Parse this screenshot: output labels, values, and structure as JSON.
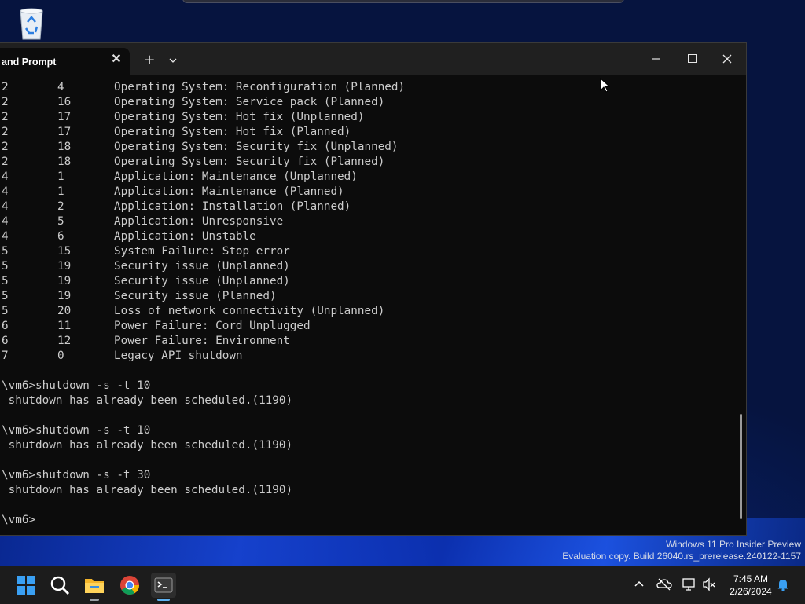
{
  "desktop": {
    "recycle_bin_icon": "recycle-bin-icon",
    "watermark_line1": "Windows 11 Pro Insider Preview",
    "watermark_line2": "Evaluation copy. Build 26040.rs_prerelease.240122-1157"
  },
  "terminal": {
    "tab_title": "and Prompt",
    "tab_close": "✕",
    "new_tab": "+",
    "dropdown": "⌄",
    "minimize": "—",
    "close": "✕",
    "reason_rows": [
      {
        "major": "2",
        "minor": "4",
        "title": "Operating System: Reconfiguration (Planned)"
      },
      {
        "major": "2",
        "minor": "16",
        "title": "Operating System: Service pack (Planned)"
      },
      {
        "major": "2",
        "minor": "17",
        "title": "Operating System: Hot fix (Unplanned)"
      },
      {
        "major": "2",
        "minor": "17",
        "title": "Operating System: Hot fix (Planned)"
      },
      {
        "major": "2",
        "minor": "18",
        "title": "Operating System: Security fix (Unplanned)"
      },
      {
        "major": "2",
        "minor": "18",
        "title": "Operating System: Security fix (Planned)"
      },
      {
        "major": "4",
        "minor": "1",
        "title": "Application: Maintenance (Unplanned)"
      },
      {
        "major": "4",
        "minor": "1",
        "title": "Application: Maintenance (Planned)"
      },
      {
        "major": "4",
        "minor": "2",
        "title": "Application: Installation (Planned)"
      },
      {
        "major": "4",
        "minor": "5",
        "title": "Application: Unresponsive"
      },
      {
        "major": "4",
        "minor": "6",
        "title": "Application: Unstable"
      },
      {
        "major": "5",
        "minor": "15",
        "title": "System Failure: Stop error"
      },
      {
        "major": "5",
        "minor": "19",
        "title": "Security issue (Unplanned)"
      },
      {
        "major": "5",
        "minor": "19",
        "title": "Security issue (Unplanned)"
      },
      {
        "major": "5",
        "minor": "19",
        "title": "Security issue (Planned)"
      },
      {
        "major": "5",
        "minor": "20",
        "title": "Loss of network connectivity (Unplanned)"
      },
      {
        "major": "6",
        "minor": "11",
        "title": "Power Failure: Cord Unplugged"
      },
      {
        "major": "6",
        "minor": "12",
        "title": "Power Failure: Environment"
      },
      {
        "major": "7",
        "minor": "0",
        "title": "Legacy API shutdown"
      }
    ],
    "session_lines": [
      "",
      "\\vm6>shutdown -s -t 10",
      " shutdown has already been scheduled.(1190)",
      "",
      "\\vm6>shutdown -s -t 10",
      " shutdown has already been scheduled.(1190)",
      "",
      "\\vm6>shutdown -s -t 30",
      " shutdown has already been scheduled.(1190)",
      "",
      "\\vm6>"
    ]
  },
  "taskbar": {
    "apps": [
      "start-icon",
      "search-icon",
      "file-explorer-icon",
      "chrome-icon",
      "terminal-icon"
    ],
    "tray_chevron": "^",
    "time": "7:45 AM",
    "date": "2/26/2024"
  }
}
